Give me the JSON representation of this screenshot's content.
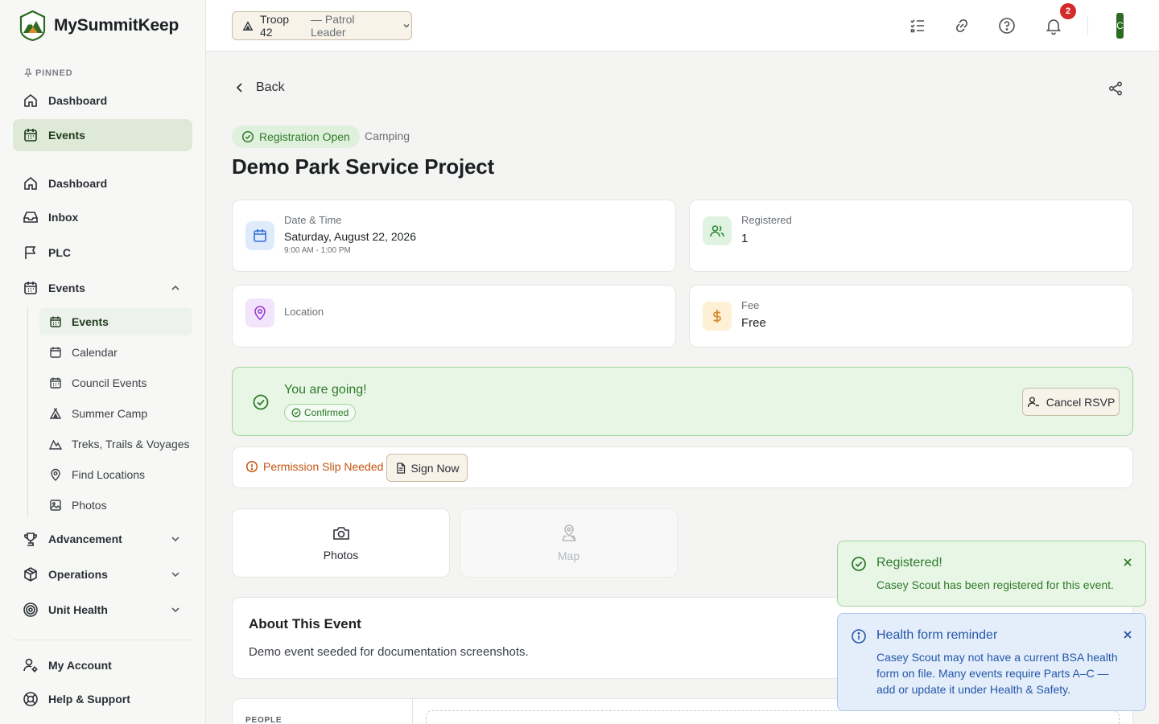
{
  "app": {
    "name": "MySummitKeep"
  },
  "sidebar": {
    "pinned_label": "PINNED",
    "pinned": [
      {
        "label": "Dashboard"
      },
      {
        "label": "Events"
      }
    ],
    "items": [
      {
        "label": "Dashboard"
      },
      {
        "label": "Inbox"
      },
      {
        "label": "PLC"
      },
      {
        "label": "Events"
      },
      {
        "label": "Advancement"
      },
      {
        "label": "Operations"
      },
      {
        "label": "Unit Health"
      }
    ],
    "events_sub": [
      {
        "label": "Events"
      },
      {
        "label": "Calendar"
      },
      {
        "label": "Council Events"
      },
      {
        "label": "Summer Camp"
      },
      {
        "label": "Treks, Trails & Voyages"
      },
      {
        "label": "Find Locations"
      },
      {
        "label": "Photos"
      }
    ],
    "footer": [
      {
        "label": "My Account"
      },
      {
        "label": "Help & Support"
      }
    ]
  },
  "topbar": {
    "troop": "Troop 42",
    "role": "— Patrol Leader",
    "notification_count": "2",
    "avatar_initial": "C"
  },
  "event": {
    "back_label": "Back",
    "status": "Registration Open",
    "category": "Camping",
    "title": "Demo Park Service Project",
    "date_label": "Date & Time",
    "date_value": "Saturday, August 22, 2026",
    "time_value": "9:00 AM - 1:00 PM",
    "registered_label": "Registered",
    "registered_value": "1",
    "location_label": "Location",
    "fee_label": "Fee",
    "fee_value": "Free"
  },
  "rsvp": {
    "title": "You are going!",
    "badge": "Confirmed",
    "cancel_label": "Cancel RSVP"
  },
  "permission": {
    "text": "Permission Slip Needed",
    "sign_label": "Sign Now"
  },
  "tiles": {
    "photos": "Photos",
    "map": "Map"
  },
  "about": {
    "title": "About This Event",
    "body": "Demo event seeded for documentation screenshots."
  },
  "people": {
    "label": "PEOPLE"
  },
  "toasts": {
    "success": {
      "title": "Registered!",
      "body": "Casey Scout has been registered for this event."
    },
    "info": {
      "title": "Health form reminder",
      "body": "Casey Scout may not have a current BSA health form on file. Many events require Parts A–C — add or update it under Health & Safety."
    }
  },
  "colors": {
    "brand_green": "#2d6a22",
    "active_nav_bg": "#dfe9d8",
    "success": "#2f7a2a",
    "warning": "#c4530e",
    "info": "#2456a8",
    "badge_red": "#d42a2a"
  }
}
